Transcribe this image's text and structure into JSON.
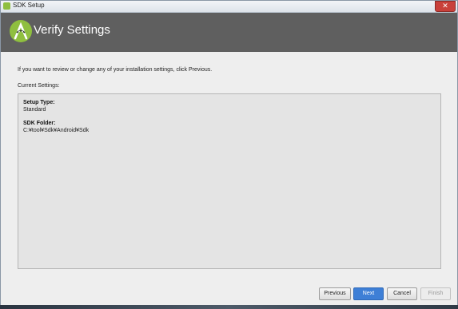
{
  "window": {
    "title": "SDK Setup",
    "close_glyph": "✕"
  },
  "header": {
    "title": "Verify Settings",
    "logo_icon": "android-studio-icon"
  },
  "main": {
    "intro": "If you want to review or change any of your installation settings, click Previous.",
    "current_settings_label": "Current Settings:",
    "settings": {
      "setup_type_label": "Setup Type:",
      "setup_type_value": "Standard",
      "sdk_folder_label": "SDK Folder:",
      "sdk_folder_value": "C:¥tool¥Sdk¥Android¥Sdk"
    }
  },
  "buttons": {
    "previous": "Previous",
    "next": "Next",
    "cancel": "Cancel",
    "finish": "Finish"
  },
  "colors": {
    "header_bg": "#5f5f5f",
    "primary_button": "#3e7fd6",
    "logo_green": "#8fbf3f"
  }
}
